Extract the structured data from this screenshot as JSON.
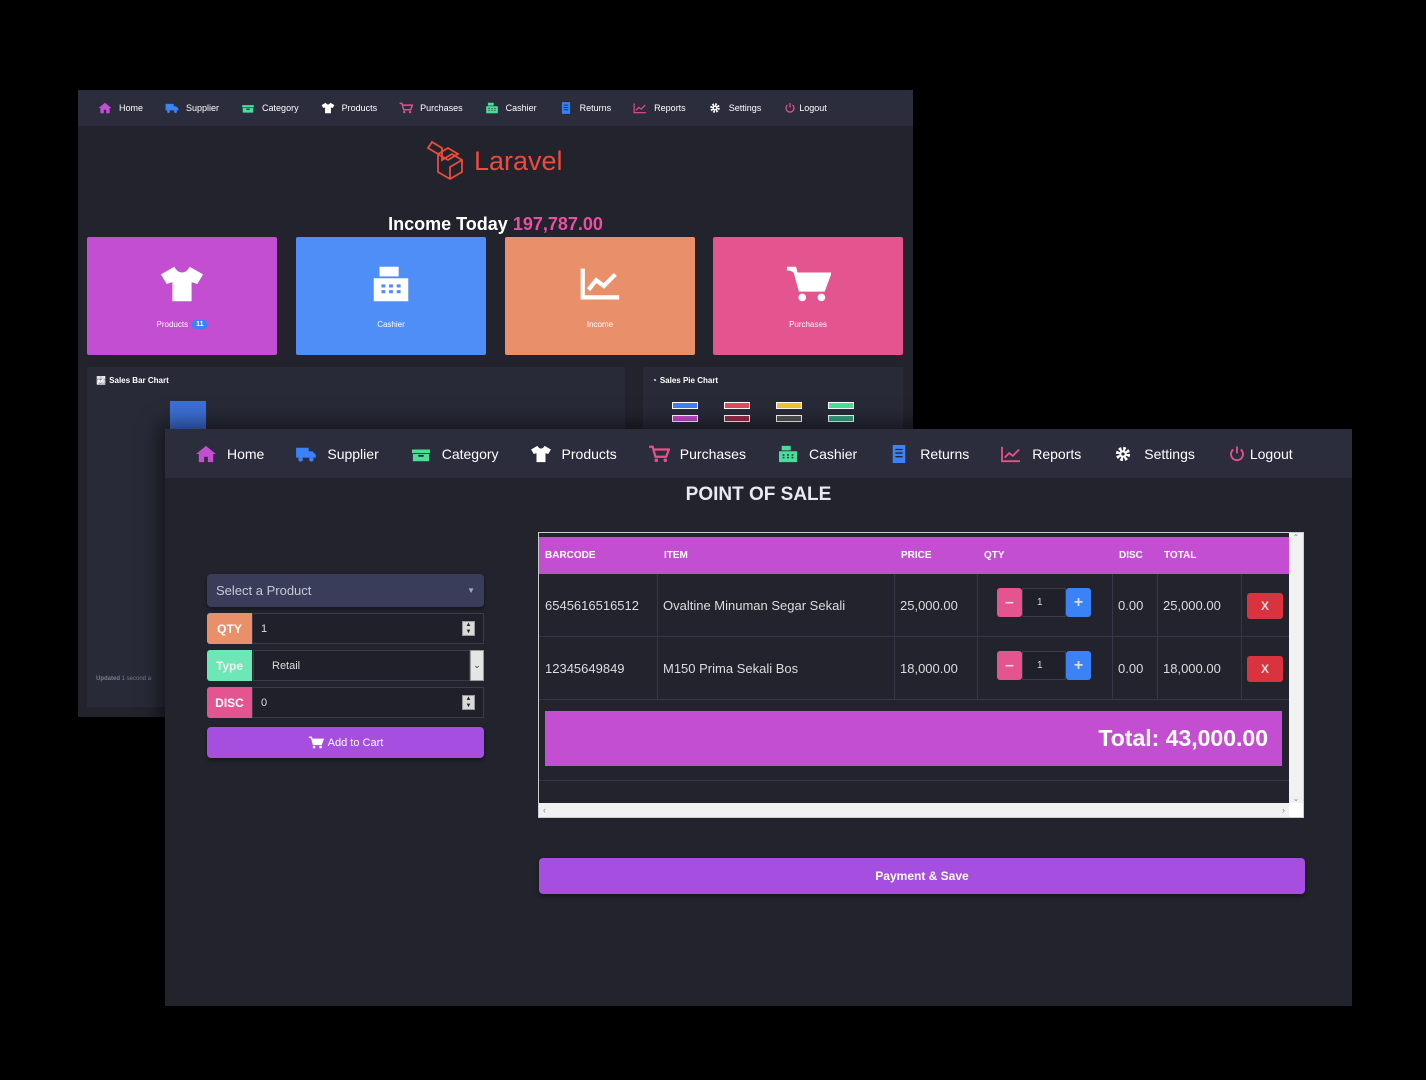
{
  "nav": {
    "items": [
      {
        "label": "Home",
        "icon": "home-icon",
        "color": "#c44ed1"
      },
      {
        "label": "Supplier",
        "icon": "truck-icon",
        "color": "#3b82f6"
      },
      {
        "label": "Category",
        "icon": "boxes-icon",
        "color": "#4ade9a"
      },
      {
        "label": "Products",
        "icon": "tshirt-icon",
        "color": "#ffffff"
      },
      {
        "label": "Purchases",
        "icon": "cart-icon",
        "color": "#e94f8a"
      },
      {
        "label": "Cashier",
        "icon": "cash-register-icon",
        "color": "#4ade9a"
      },
      {
        "label": "Returns",
        "icon": "document-icon",
        "color": "#3b82f6"
      },
      {
        "label": "Reports",
        "icon": "chart-line-icon",
        "color": "#e94f8a"
      },
      {
        "label": "Settings",
        "icon": "gear-icon",
        "color": "#ffffff"
      },
      {
        "label": "Logout",
        "icon": "power-icon",
        "color": "#e94f8a"
      }
    ]
  },
  "dashboard": {
    "logo_text": "Laravel",
    "income_label": "Income Today",
    "income_value": "197,787.00",
    "tiles": [
      {
        "label": "Products",
        "badge": "11",
        "icon": "tshirt-icon",
        "color": "#c44ed1"
      },
      {
        "label": "Cashier",
        "icon": "cash-register-icon",
        "color": "#4f8ef7"
      },
      {
        "label": "Income",
        "icon": "chart-line-icon",
        "color": "#e9906a"
      },
      {
        "label": "Purchases",
        "icon": "cart-icon",
        "color": "#e4548e"
      }
    ],
    "bar_chart_title": "Sales Bar Chart",
    "pie_chart_title": "Sales Pie Chart",
    "updated_label": "Updated",
    "updated_text": "1 second a"
  },
  "pos": {
    "title": "POINT OF SALE",
    "select_placeholder": "Select a Product",
    "qty_label": "QTY",
    "qty_value": "1",
    "type_label": "Type",
    "type_value": "Retail",
    "disc_label": "DISC",
    "disc_value": "0",
    "add_to_cart": "Add to Cart",
    "columns": [
      "BARCODE",
      "ITEM",
      "PRICE",
      "QTY",
      "DISC",
      "TOTAL"
    ],
    "rows": [
      {
        "barcode": "6545616516512",
        "item": "Ovaltine Minuman Segar Sekali",
        "price": "25,000.00",
        "qty": "1",
        "disc": "0.00",
        "total": "25,000.00"
      },
      {
        "barcode": "12345649849",
        "item": "M150 Prima Sekali Bos",
        "price": "18,000.00",
        "qty": "1",
        "disc": "0.00",
        "total": "18,000.00"
      }
    ],
    "delete_label": "X",
    "total_label": "Total: 43,000.00",
    "pay_button": "Payment & Save"
  }
}
